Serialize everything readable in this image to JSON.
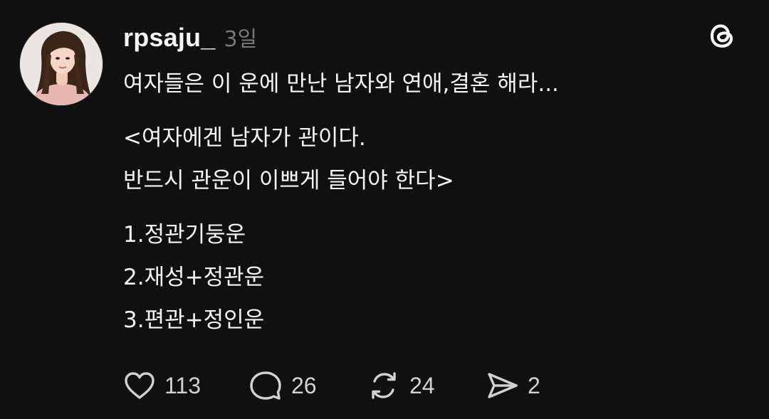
{
  "post": {
    "username": "rpsaju_",
    "timestamp": "3일",
    "body": {
      "line1": "여자들은 이 운에 만난 남자와 연애,결혼 해라...",
      "line2": "<여자에겐 남자가 관이다.",
      "line3": "반드시 관운이 이쁘게 들어야 한다>",
      "line4": "1.정관기둥운",
      "line5": "2.재성+정관운",
      "line6": "3.편관+정인운"
    },
    "actions": {
      "likes": "113",
      "replies": "26",
      "reposts": "24",
      "shares": "2"
    }
  },
  "icons": {
    "brand": "threads-logo-icon",
    "like": "heart-icon",
    "reply": "speech-bubble-icon",
    "repost": "repost-arrows-icon",
    "share": "send-paper-plane-icon"
  },
  "colors": {
    "background": "#101010",
    "text": "#f3f5f7",
    "muted": "#777777",
    "icon": "#cfd1d3"
  }
}
